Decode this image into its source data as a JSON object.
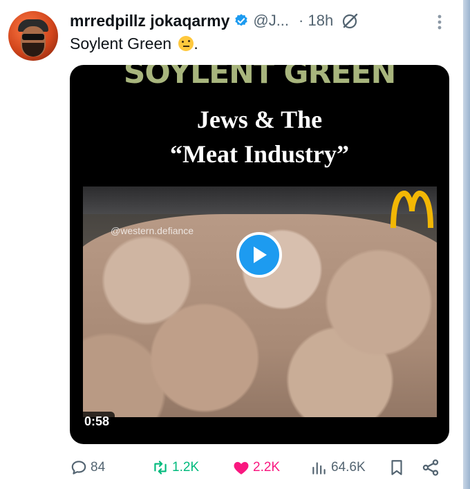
{
  "post": {
    "display_name": "mrredpillz jokaqarmy",
    "handle": "@J...",
    "time": "· 18h",
    "text": "Soylent Green",
    "text_suffix": "."
  },
  "media": {
    "banner_title": "SOYLENT GREEN",
    "headline_line1": "Jews & The",
    "headline_line2": "“Meat Industry”",
    "watermark": "@western.defiance",
    "duration": "0:58"
  },
  "metrics": {
    "replies": "84",
    "reposts": "1.2K",
    "likes": "2.2K",
    "views": "64.6K"
  },
  "icons": {
    "verified": "verified-badge-icon",
    "grok": "grok-icon",
    "more": "more-vertical-icon",
    "play": "play-icon",
    "reply": "reply-icon",
    "repost": "repost-icon",
    "like": "heart-icon",
    "views": "views-chart-icon",
    "bookmark": "bookmark-icon",
    "share": "share-icon"
  },
  "colors": {
    "verified_blue": "#1d9bf0",
    "repost_green": "#00ba7c",
    "like_pink": "#f91880",
    "muted_gray": "#536471"
  }
}
